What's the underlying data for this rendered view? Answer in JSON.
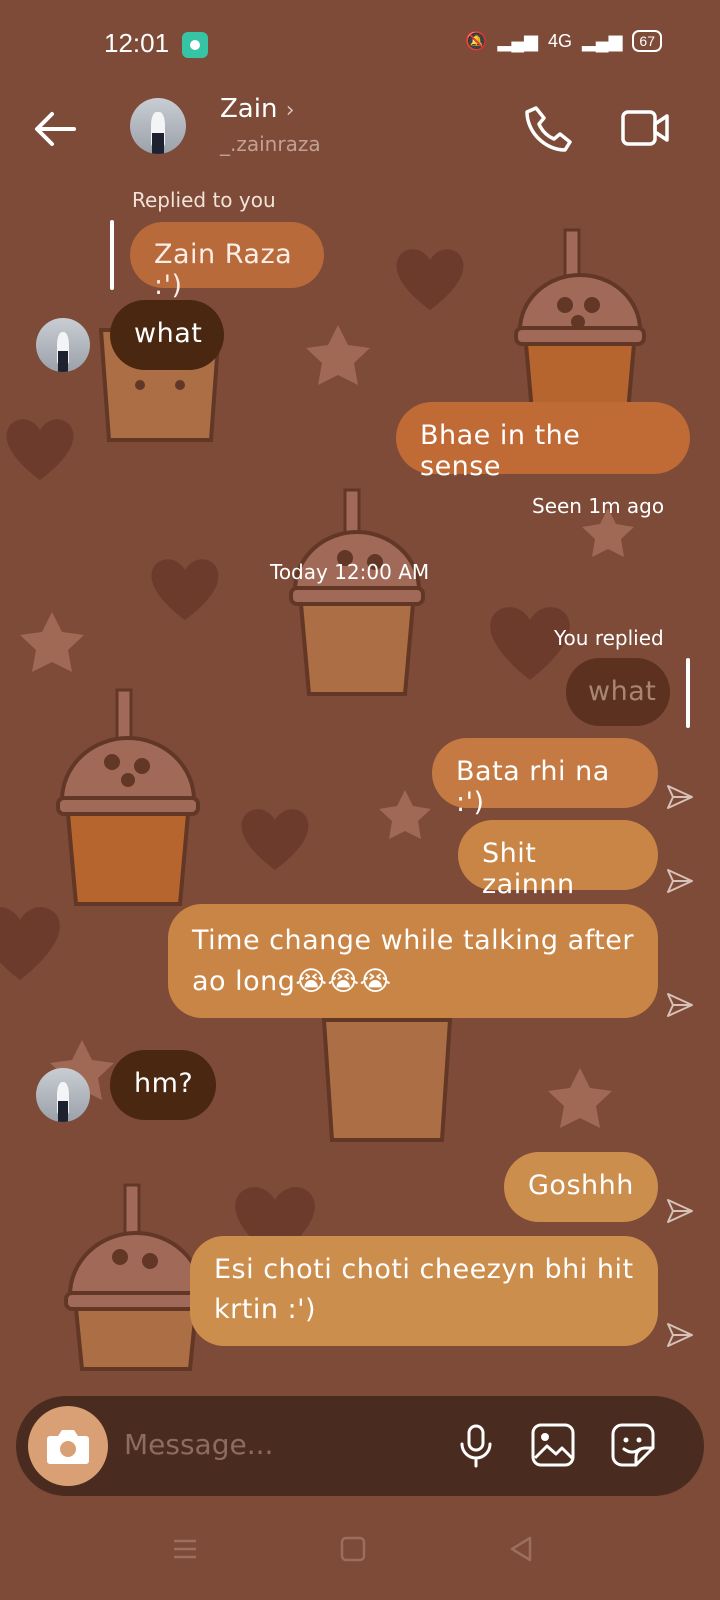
{
  "status_bar": {
    "time": "12:01",
    "network": "4G",
    "battery": "67"
  },
  "header": {
    "name": "Zain",
    "handle": "_.zainraza"
  },
  "messages": {
    "replied_label": "Replied to you",
    "replied_quote": "Zain Raza :')",
    "m1": "what",
    "m2": "Bhae in the sense",
    "seen": "Seen 1m ago",
    "time_divider": "Today 12:00 AM",
    "you_replied_label": "You replied",
    "you_replied_quote": "what",
    "m3": "Bata rhi na :')",
    "m4": "Shit zainnn",
    "m5_line1": "Time change while talking after",
    "m5_line2": "ao long😭😭😭",
    "m6": "hm?",
    "m7": "Goshhh",
    "m8_line1": "Esi choti choti cheezyn bhi hit",
    "m8_line2": "krtin :')"
  },
  "composer": {
    "placeholder": "Message..."
  },
  "icons": {
    "back": "arrow-left",
    "call": "phone",
    "video": "video-camera",
    "camera": "camera",
    "mic": "microphone",
    "gallery": "image",
    "sticker": "sticker-smile",
    "send": "paper-plane"
  },
  "colors": {
    "background": "#7d4b38",
    "bubble_outgoing": "#c06a36",
    "bubble_incoming": "#4a2710"
  }
}
